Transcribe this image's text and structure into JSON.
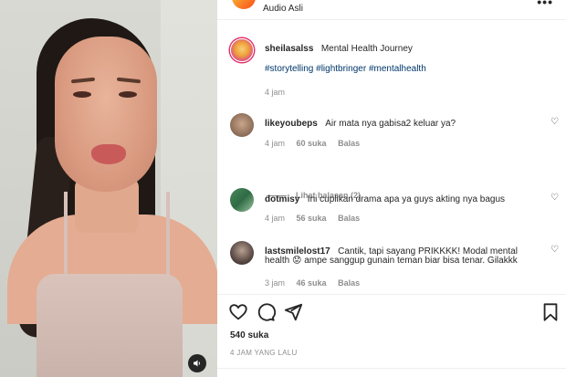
{
  "header": {
    "audio_label": "Audio Asli",
    "more_icon": "more-horizontal-icon"
  },
  "caption": {
    "username": "sheilasalss",
    "text": "Mental Health Journey",
    "hashtags": "#storytelling #lightbringer #mentalhealth",
    "time": "4 jam"
  },
  "comments": [
    {
      "username": "likeyoubeps",
      "text": "Air mata nya gabisa2 keluar ya?",
      "time": "4 jam",
      "likes": "60 suka",
      "reply": "Balas"
    },
    {
      "username": "dotmisy",
      "text": "Ini cuplikan drama apa ya guys akting nya bagus",
      "time": "4 jam",
      "likes": "56 suka",
      "reply": "Balas"
    },
    {
      "username": "lastsmilelost17",
      "text_line1": "Cantik, tapi sayang PRIKKKK! Modal mental",
      "text_line2": "health 😟 ampe sanggup gunain teman biar bisa tenar. Gilakkk",
      "time": "3 jam",
      "likes": "46 suka",
      "reply": "Balas"
    }
  ],
  "view_replies": "Lihat balasan (2)",
  "post": {
    "likes": "540 suka",
    "ago": "4 JAM YANG LALU"
  },
  "colors": {
    "link": "#00376b",
    "muted": "#8e8e8e",
    "text": "#262626"
  }
}
